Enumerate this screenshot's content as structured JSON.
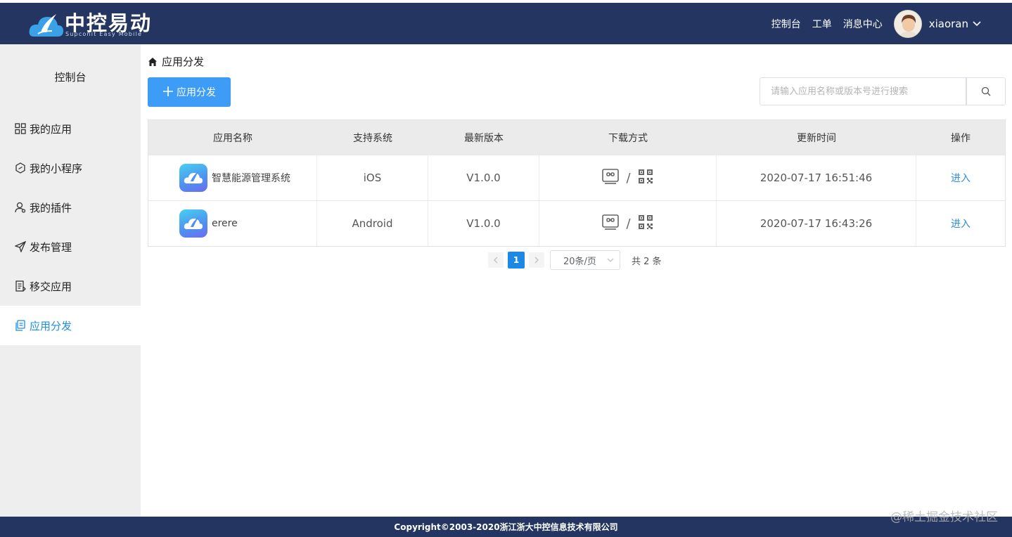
{
  "header": {
    "logo_title": "中控易动",
    "logo_subtitle": "Supconit Easy Mobile",
    "nav": [
      "控制台",
      "工单",
      "消息中心"
    ],
    "username": "xiaoran",
    "colors": {
      "bar": "#233560"
    }
  },
  "sidebar": {
    "home_label": "控制台",
    "items": [
      {
        "label": "我的应用",
        "icon": "grid-icon"
      },
      {
        "label": "我的小程序",
        "icon": "hexagon-icon"
      },
      {
        "label": "我的插件",
        "icon": "user-plugin-icon"
      },
      {
        "label": "发布管理",
        "icon": "paper-plane-icon"
      },
      {
        "label": "移交应用",
        "icon": "document-icon"
      },
      {
        "label": "应用分发",
        "icon": "copy-icon",
        "active": true
      }
    ]
  },
  "main": {
    "breadcrumb": "应用分发",
    "add_button": "应用分发",
    "search_placeholder": "请输入应用名称或版本号进行搜索"
  },
  "table": {
    "columns": [
      "应用名称",
      "支持系统",
      "最新版本",
      "下载方式",
      "更新时间",
      "操作"
    ],
    "rows": [
      {
        "name": "智慧能源管理系统",
        "system": "iOS",
        "version": "V1.0.0",
        "download_sep": "/",
        "updated": "2020-07-17 16:51:46",
        "action": "进入"
      },
      {
        "name": "erere",
        "system": "Android",
        "version": "V1.0.0",
        "download_sep": "/",
        "updated": "2020-07-17 16:43:26",
        "action": "进入"
      }
    ]
  },
  "pagination": {
    "current_page": "1",
    "page_size": "20条/页",
    "total": "共 2 条"
  },
  "footer": {
    "copyright": "Copyright©2003-2020浙江浙大中控信息技术有限公司"
  },
  "watermark": "@稀土掘金技术社区"
}
